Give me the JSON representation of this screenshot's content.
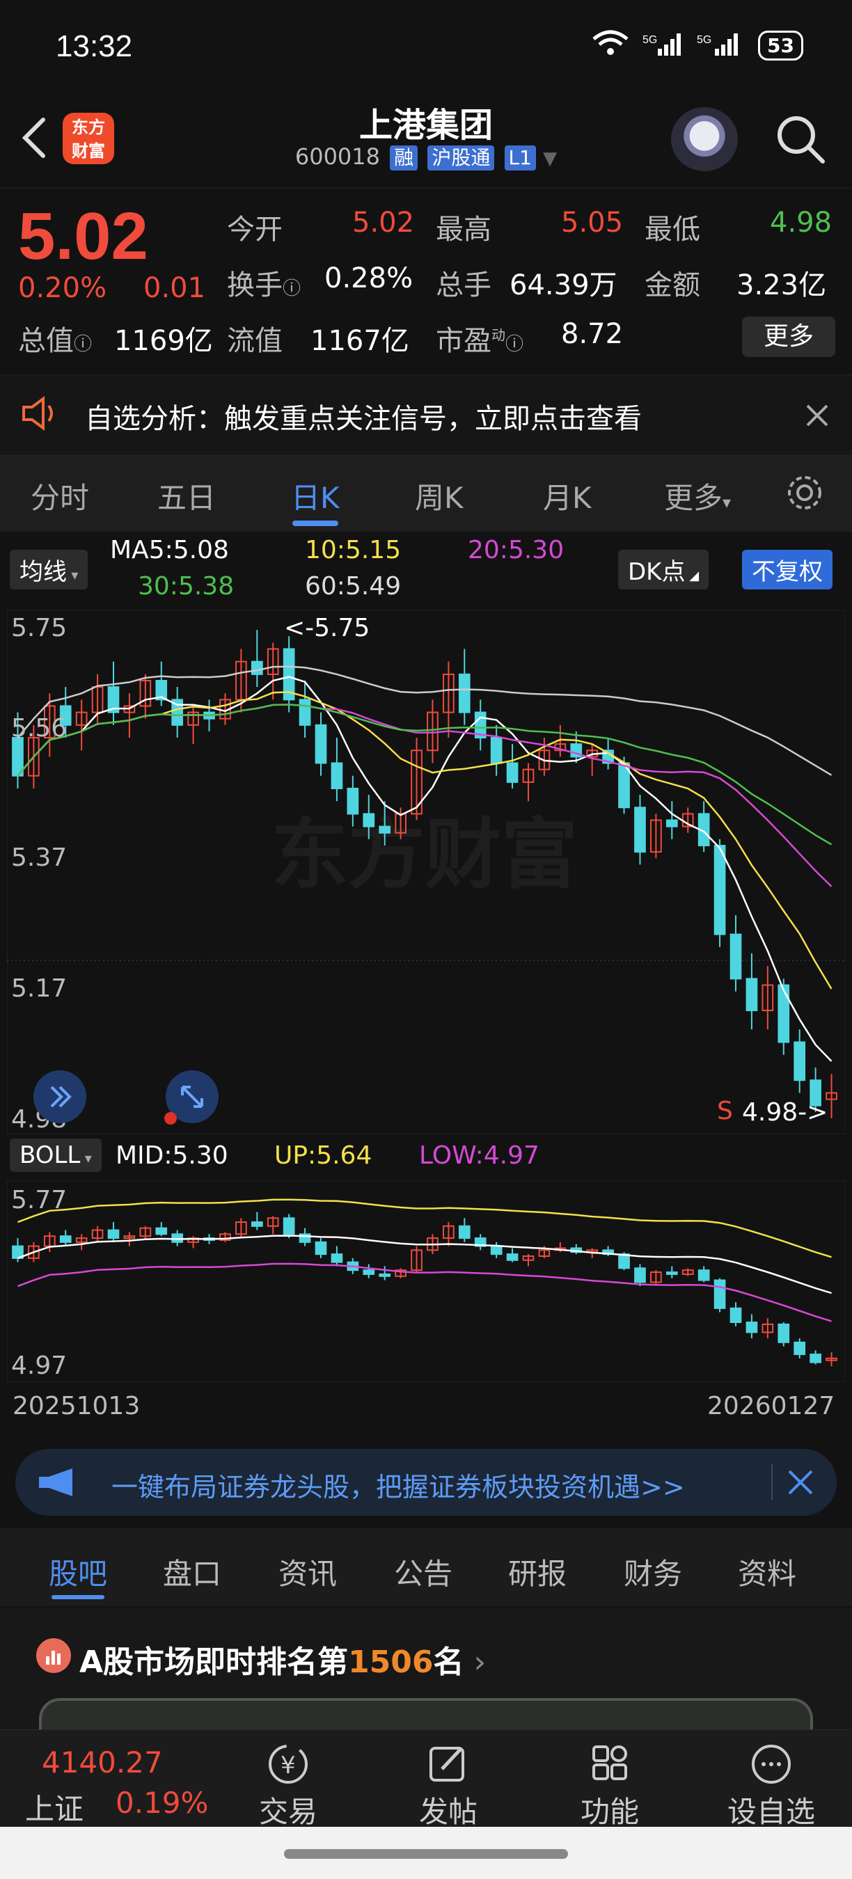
{
  "status": {
    "time": "13:32",
    "battery": "53",
    "network": [
      "6",
      "5G",
      "5G"
    ]
  },
  "header": {
    "title": "上港集团",
    "code": "600018",
    "tags": [
      "融",
      "沪股通",
      "L1"
    ],
    "logo_text": [
      "东方",
      "财富"
    ]
  },
  "quote": {
    "price": "5.02",
    "change_pct": "0.20%",
    "change": "0.01",
    "open_label": "今开",
    "open": "5.02",
    "high_label": "最高",
    "high": "5.05",
    "low_label": "最低",
    "low": "4.98",
    "turnover_label": "换手",
    "turnover": "0.28%",
    "volume_label": "总手",
    "volume": "64.39万",
    "amount_label": "金额",
    "amount": "3.23亿",
    "total_value_label": "总值",
    "total_value": "1169亿",
    "float_value_label": "流值",
    "float_value": "1167亿",
    "pe_label": "市盈",
    "pe_sup": "动",
    "pe": "8.72",
    "more_label": "更多"
  },
  "alert": {
    "text": "自选分析：触发重点关注信号，立即点击查看"
  },
  "tabs": [
    "分时",
    "五日",
    "日K",
    "周K",
    "月K",
    "更多"
  ],
  "active_tab": "日K",
  "ma": {
    "selector": "均线",
    "ma5": "MA5:5.08",
    "ma10": "10:5.15",
    "ma20": "20:5.30",
    "ma30": "30:5.38",
    "ma60": "60:5.49",
    "dk_label": "DK点",
    "adjust_label": "不复权"
  },
  "colors": {
    "up": "#f04b3c",
    "down": "#4fd5e0",
    "ma5": "#ffffff",
    "ma10": "#f5e04a",
    "ma20": "#d54ad5",
    "ma30": "#4fbf4f",
    "ma60": "#cccccc",
    "accent": "#4f8ef0"
  },
  "main_axis": {
    "ticks": [
      "5.75",
      "5.56",
      "5.37",
      "5.17",
      "4.98"
    ],
    "max_label": "<-5.75",
    "min_label": "4.98->",
    "s_label": "S"
  },
  "boll": {
    "selector": "BOLL",
    "mid": "MID:5.30",
    "up": "UP:5.64",
    "low": "LOW:4.97",
    "ticks": [
      "5.77",
      "4.97"
    ]
  },
  "dates": {
    "start": "20251013",
    "end": "20260127"
  },
  "ad": {
    "text": "一键布局证券龙头股，把握证券板块投资机遇>>"
  },
  "bottom_tabs": [
    "股吧",
    "盘口",
    "资讯",
    "公告",
    "研报",
    "财务",
    "资料"
  ],
  "rank": {
    "prefix": "A股市场即时排名第",
    "number": "1506",
    "suffix": "名"
  },
  "dock": {
    "index_value": "4140.27",
    "index_name": "上证",
    "index_change": "0.19%",
    "items": [
      "交易",
      "发帖",
      "功能",
      "设自选"
    ]
  },
  "candles": [
    [
      5.58,
      5.62,
      5.5,
      5.52
    ],
    [
      5.52,
      5.6,
      5.5,
      5.58
    ],
    [
      5.58,
      5.65,
      5.55,
      5.63
    ],
    [
      5.63,
      5.66,
      5.58,
      5.6
    ],
    [
      5.6,
      5.64,
      5.56,
      5.62
    ],
    [
      5.62,
      5.68,
      5.6,
      5.66
    ],
    [
      5.66,
      5.7,
      5.6,
      5.62
    ],
    [
      5.62,
      5.65,
      5.58,
      5.63
    ],
    [
      5.63,
      5.68,
      5.61,
      5.67
    ],
    [
      5.67,
      5.7,
      5.63,
      5.64
    ],
    [
      5.64,
      5.66,
      5.58,
      5.6
    ],
    [
      5.6,
      5.63,
      5.57,
      5.62
    ],
    [
      5.62,
      5.64,
      5.59,
      5.61
    ],
    [
      5.61,
      5.65,
      5.6,
      5.64
    ],
    [
      5.64,
      5.72,
      5.62,
      5.7
    ],
    [
      5.7,
      5.75,
      5.66,
      5.68
    ],
    [
      5.68,
      5.73,
      5.64,
      5.72
    ],
    [
      5.72,
      5.74,
      5.62,
      5.64
    ],
    [
      5.64,
      5.67,
      5.58,
      5.6
    ],
    [
      5.6,
      5.62,
      5.52,
      5.54
    ],
    [
      5.54,
      5.58,
      5.48,
      5.5
    ],
    [
      5.5,
      5.52,
      5.44,
      5.46
    ],
    [
      5.46,
      5.49,
      5.42,
      5.44
    ],
    [
      5.44,
      5.48,
      5.41,
      5.43
    ],
    [
      5.43,
      5.47,
      5.42,
      5.46
    ],
    [
      5.46,
      5.58,
      5.45,
      5.56
    ],
    [
      5.56,
      5.64,
      5.54,
      5.62
    ],
    [
      5.62,
      5.7,
      5.58,
      5.68
    ],
    [
      5.68,
      5.72,
      5.6,
      5.62
    ],
    [
      5.62,
      5.64,
      5.56,
      5.58
    ],
    [
      5.58,
      5.6,
      5.52,
      5.54
    ],
    [
      5.54,
      5.57,
      5.5,
      5.51
    ],
    [
      5.51,
      5.54,
      5.48,
      5.53
    ],
    [
      5.53,
      5.58,
      5.52,
      5.56
    ],
    [
      5.56,
      5.6,
      5.55,
      5.57
    ],
    [
      5.57,
      5.59,
      5.54,
      5.55
    ],
    [
      5.55,
      5.57,
      5.52,
      5.56
    ],
    [
      5.56,
      5.58,
      5.53,
      5.54
    ],
    [
      5.54,
      5.55,
      5.46,
      5.47
    ],
    [
      5.47,
      5.49,
      5.38,
      5.4
    ],
    [
      5.4,
      5.46,
      5.39,
      5.45
    ],
    [
      5.45,
      5.48,
      5.42,
      5.44
    ],
    [
      5.44,
      5.47,
      5.43,
      5.46
    ],
    [
      5.46,
      5.48,
      5.4,
      5.41
    ],
    [
      5.41,
      5.42,
      5.25,
      5.27
    ],
    [
      5.27,
      5.3,
      5.18,
      5.2
    ],
    [
      5.2,
      5.24,
      5.12,
      5.15
    ],
    [
      5.15,
      5.22,
      5.12,
      5.19
    ],
    [
      5.19,
      5.2,
      5.08,
      5.1
    ],
    [
      5.1,
      5.12,
      5.02,
      5.04
    ],
    [
      5.04,
      5.06,
      4.99,
      5.0
    ],
    [
      5.01,
      5.05,
      4.98,
      5.02
    ]
  ]
}
